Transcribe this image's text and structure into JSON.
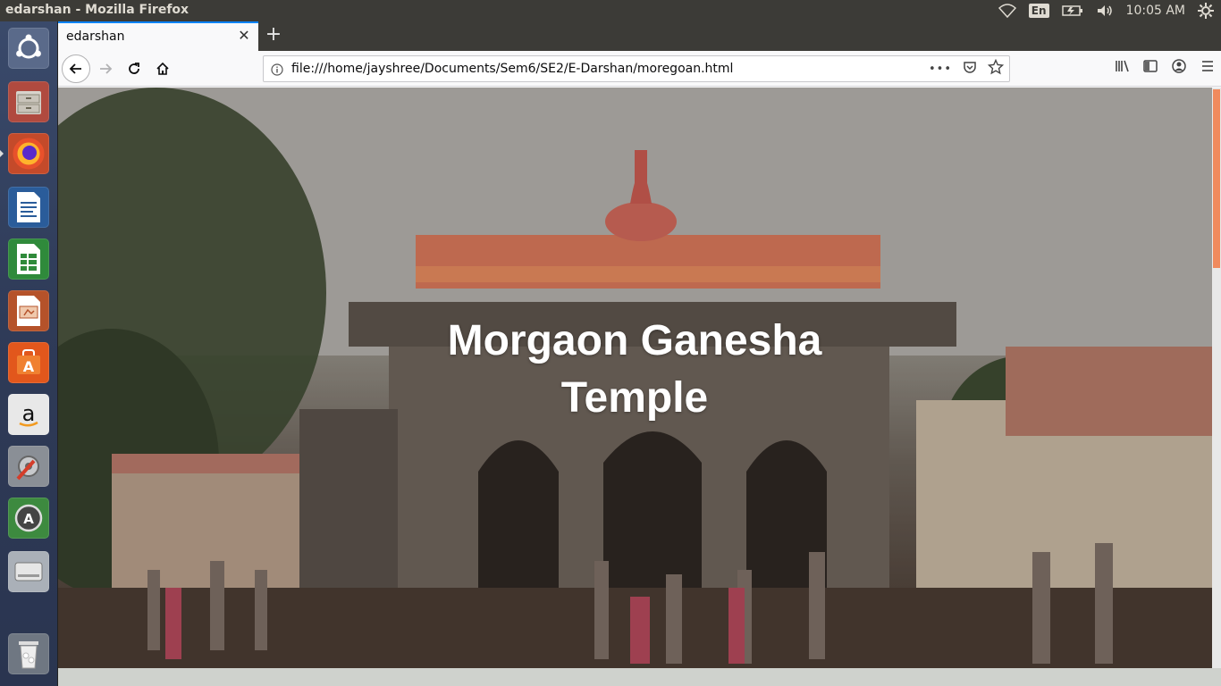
{
  "system": {
    "window_title": "edarshan - Mozilla Firefox",
    "keyboard_layout": "En",
    "clock": "10:05 AM"
  },
  "launcher": {
    "items": [
      {
        "name": "Ubuntu dash",
        "icon": "ubuntu-logo-icon"
      },
      {
        "name": "Files",
        "icon": "file-cabinet-icon"
      },
      {
        "name": "Firefox",
        "icon": "firefox-icon"
      },
      {
        "name": "LibreOffice Writer",
        "icon": "writer-icon"
      },
      {
        "name": "LibreOffice Calc",
        "icon": "calc-icon"
      },
      {
        "name": "LibreOffice Impress",
        "icon": "impress-icon"
      },
      {
        "name": "Ubuntu Software",
        "icon": "software-center-icon"
      },
      {
        "name": "Amazon",
        "icon": "amazon-icon"
      },
      {
        "name": "System Settings",
        "icon": "settings-icon"
      },
      {
        "name": "Software Updater",
        "icon": "software-updater-icon"
      },
      {
        "name": "Disk",
        "icon": "disk-icon"
      },
      {
        "name": "Trash",
        "icon": "trash-icon"
      }
    ]
  },
  "browser": {
    "tab_title": "edarshan",
    "url": "file:///home/jayshree/Documents/Sem6/SE2/E-Darshan/moregoan.html",
    "url_more": "•••"
  },
  "page": {
    "hero_title": "Morgaon Ganesha Temple"
  },
  "colors": {
    "panel": "#3c3b37",
    "accent": "#0a84ff",
    "scroll_thumb": "#f08a5d",
    "title_text": "#ffffff"
  }
}
